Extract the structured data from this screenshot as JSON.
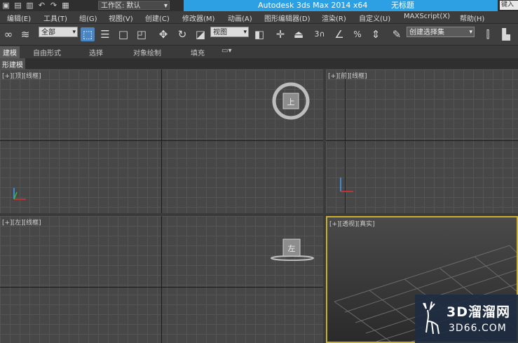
{
  "title_bar": {
    "workspace_label": "工作区: 默认",
    "app_title": "Autodesk 3ds Max  2014 x64",
    "file_title": "无标题",
    "search_placeholder": "键入关"
  },
  "menu": {
    "items": [
      {
        "label": "编辑(E)"
      },
      {
        "label": "工具(T)"
      },
      {
        "label": "组(G)"
      },
      {
        "label": "视图(V)"
      },
      {
        "label": "创建(C)"
      },
      {
        "label": "修改器(M)"
      },
      {
        "label": "动画(A)"
      },
      {
        "label": "图形编辑器(D)"
      },
      {
        "label": "渲染(R)"
      },
      {
        "label": "自定义(U)"
      },
      {
        "label": "MAXScript(X)"
      },
      {
        "label": "帮助(H)"
      }
    ]
  },
  "toolbar": {
    "selection_filter": "全部",
    "reference_coord": "视图",
    "named_selection": "创建选择集",
    "snap_label": "3",
    "percent_label": "%"
  },
  "ribbon": {
    "tabs": [
      {
        "label": "建模"
      },
      {
        "label": "自由形式"
      },
      {
        "label": "选择"
      },
      {
        "label": "对象绘制"
      },
      {
        "label": "填充"
      }
    ],
    "sub_panel": "形建模"
  },
  "viewports": {
    "top": {
      "label": "[+][顶][线框]",
      "gizmo_text": "上"
    },
    "front": {
      "label": "[+][前][线框]"
    },
    "left": {
      "label": "[+][左][线框]",
      "gizmo_text": "左"
    },
    "perspective": {
      "label": "[+][透视][真实]"
    }
  },
  "watermark": {
    "line1": "3D溜溜网",
    "line2": "3D66.COM"
  },
  "colors": {
    "title_accent": "#2d9fe3",
    "viewport_bg": "#474747",
    "active_viewport_border": "#c8b030",
    "watermark_bg": "#1e2c42"
  }
}
